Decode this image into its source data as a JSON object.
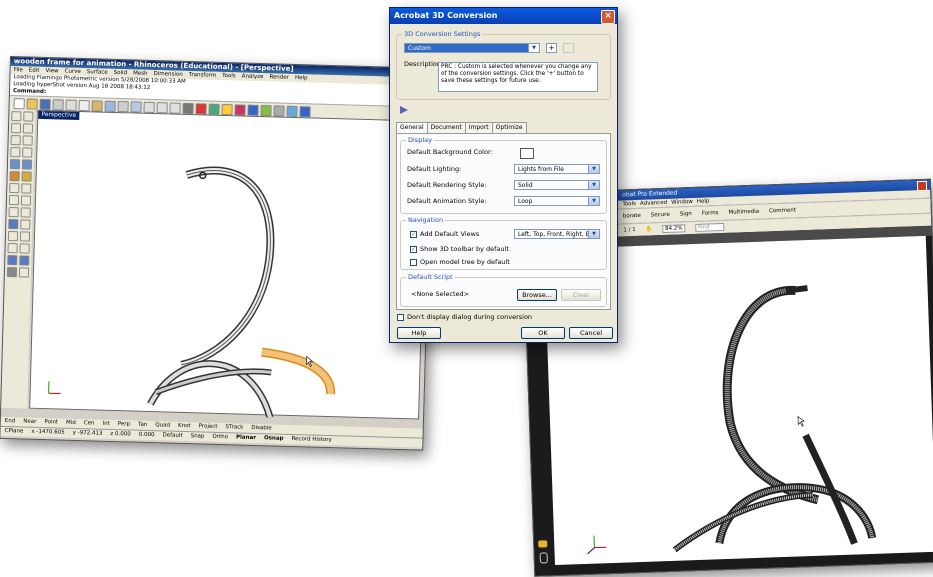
{
  "rhino": {
    "title": "wooden frame for animation - Rhinoceros (Educational) - [Perspective]",
    "menus": [
      "File",
      "Edit",
      "View",
      "Curve",
      "Surface",
      "Solid",
      "Mesh",
      "Dimension",
      "Transform",
      "Tools",
      "Analyze",
      "Render",
      "Help"
    ],
    "history": [
      "Loading Flamingo Photometric version 5/28/2008 10:00:33 AM",
      "Loading hyperShot version Aug 18 2008 18:43:12"
    ],
    "command_label": "Command:",
    "viewport_label": "Perspective",
    "snaps": [
      "End",
      "Near",
      "Point",
      "Mid",
      "Cen",
      "Int",
      "Perp",
      "Tan",
      "Quad",
      "Knot",
      "Project",
      "STrack",
      "Disable"
    ],
    "status": [
      "CPlane",
      "x -1470.605",
      "y -972.413",
      "z 0.000",
      "0.000",
      "Default",
      "Snap",
      "Ortho",
      "Planar",
      "Osnap",
      "Record History"
    ]
  },
  "acrobat": {
    "title": "obat Pro Extended",
    "menus": [
      "Tools",
      "Advanced",
      "Window",
      "Help"
    ],
    "toolbar": [
      "borate",
      "Secure",
      "Sign",
      "Forms",
      "Multimedia",
      "Comment"
    ],
    "page_nav": "1 / 1",
    "zoom": "84.2%",
    "find_placeholder": "Find"
  },
  "dialog": {
    "title": "Acrobat 3D Conversion",
    "close": "×",
    "settings_group": "3D Conversion Settings",
    "preset": "Custom",
    "plus": "+",
    "description_label": "Description",
    "description": "PRC : Custom is selected whenever you change any of the conversion settings. Click the '+' button to save these settings for future use.",
    "tabs": [
      "General",
      "Document",
      "Import",
      "Optimize"
    ],
    "display_group": "Display",
    "bg_label": "Default Background Color:",
    "lighting_label": "Default Lighting:",
    "lighting_value": "Lights from File",
    "render_label": "Default Rendering Style:",
    "render_value": "Solid",
    "anim_label": "Default Animation Style:",
    "anim_value": "Loop",
    "nav_group": "Navigation",
    "add_views_label": "Add Default Views",
    "add_views_value": "Left, Top, Front, Right, B",
    "show_toolbar_label": "Show 3D toolbar by default",
    "open_tree_label": "Open model tree by default",
    "script_group": "Default Script",
    "script_value": "<None Selected>",
    "browse": "Browse...",
    "clear": "Clear",
    "dont_display": "Don't display dialog during conversion",
    "help": "Help",
    "ok": "OK",
    "cancel": "Cancel",
    "checkmark": "✓"
  }
}
